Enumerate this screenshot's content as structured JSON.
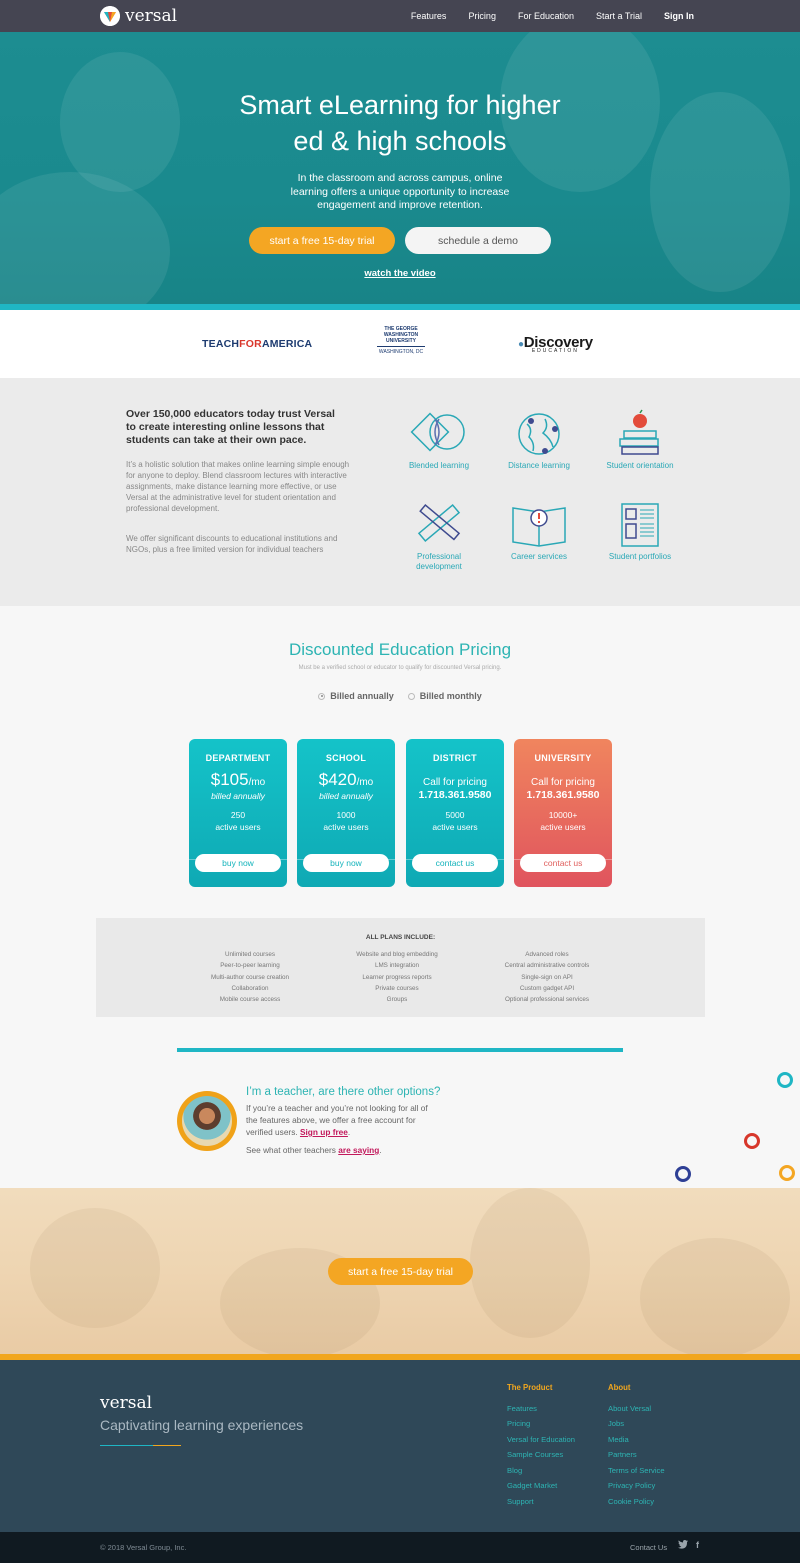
{
  "nav": {
    "brand": "versal",
    "links": [
      "Features",
      "Pricing",
      "For Education",
      "Start a Trial"
    ],
    "signin": "Sign In"
  },
  "hero": {
    "title_line1": "Smart eLearning for higher",
    "title_line2": "ed & high schools",
    "subtitle": "In the classroom and across campus, online learning offers a unique opportunity to increase engagement and improve retention.",
    "trial_button": "start a free 15-day trial",
    "demo_button": "schedule a demo",
    "video_link": "watch the video"
  },
  "partners": {
    "tfa_teach": "TEACH",
    "tfa_for": "FOR",
    "tfa_america": "AMERICA",
    "gwu_name": "THE GEORGE WASHINGTON UNIVERSITY",
    "gwu_loc": "WASHINGTON, DC",
    "discovery": "Discovery",
    "discovery_sub": "EDUCATION"
  },
  "features": {
    "headline": "Over 150,000 educators today trust Versal to create interesting online lessons that students can take at their own pace.",
    "para1": "It’s a holistic solution that makes online learning simple enough for anyone to deploy. Blend classroom lectures with interactive assignments, make distance learning more effective, or use Versal at the administrative level for student orientation and professional development.",
    "para2": "We offer significant discounts to educational institutions and NGOs, plus a free limited version for individual teachers",
    "items": [
      {
        "label": "Blended learning",
        "icon": "blended-learning-icon"
      },
      {
        "label": "Distance learning",
        "icon": "globe-icon"
      },
      {
        "label": "Student orientation",
        "icon": "apple-books-icon"
      },
      {
        "label": "Professional development",
        "icon": "ruler-pencil-icon"
      },
      {
        "label": "Career services",
        "icon": "book-alert-icon"
      },
      {
        "label": "Student portfolios",
        "icon": "portfolio-icon"
      }
    ]
  },
  "pricing": {
    "title": "Discounted Education Pricing",
    "subtitle": "Must be a verified school or educator to qualify for discounted Versal pricing.",
    "billing_annual": "Billed annually",
    "billing_monthly": "Billed monthly",
    "billing_selected": "annually",
    "plans": [
      {
        "name": "DEPARTMENT",
        "price": "$105",
        "per": "/mo",
        "billed": "billed annually",
        "users": "250",
        "users_label": "active users",
        "button": "buy now"
      },
      {
        "name": "SCHOOL",
        "price": "$420",
        "per": "/mo",
        "billed": "billed annually",
        "users": "1000",
        "users_label": "active users",
        "button": "buy now"
      },
      {
        "name": "DISTRICT",
        "call": "Call for pricing",
        "phone": "1.718.361.9580",
        "users": "5000",
        "users_label": "active users",
        "button": "contact us"
      },
      {
        "name": "UNIVERSITY",
        "call": "Call for pricing",
        "phone": "1.718.361.9580",
        "users": "10000+",
        "users_label": "active users",
        "button": "contact us"
      }
    ],
    "included_title": "ALL PLANS INCLUDE:",
    "included": [
      [
        "Unlimited courses",
        "Peer-to-peer learning",
        "Multi-author course creation",
        "Collaboration",
        "Mobile course access"
      ],
      [
        "Website and blog embedding",
        "LMS integration",
        "Learner progress reports",
        "Private courses",
        "Groups"
      ],
      [
        "Advanced roles",
        "Central administrative controls",
        "Single-sign on API",
        "Custom gadget API",
        "Optional professional services"
      ]
    ]
  },
  "teacher": {
    "heading": "I’m a teacher, are there other options?",
    "body": "If you’re a teacher and you’re not looking for all of the features above, we offer a free account for verified users.",
    "signup": "Sign up free",
    "see": "See what other teachers",
    "saying": "are saying"
  },
  "banner": {
    "button": "start a free 15-day trial"
  },
  "footer": {
    "brand": "versal",
    "tagline": "Captivating learning experiences",
    "product_title": "The Product",
    "product_links": [
      "Features",
      "Pricing",
      "Versal for Education",
      "Sample Courses",
      "Blog",
      "Gadget Market",
      "Support"
    ],
    "about_title": "About",
    "about_links": [
      "About Versal",
      "Jobs",
      "Media",
      "Partners",
      "Terms of Service",
      "Privacy Policy",
      "Cookie Policy"
    ],
    "copyright": "© 2018 Versal Group, Inc.",
    "contact": "Contact Us",
    "social": [
      "twitter-icon",
      "facebook-icon"
    ]
  },
  "colors": {
    "teal": "#1fb6c4",
    "orange": "#f4a623",
    "nav": "#454552",
    "footer": "#2f4858",
    "accent_text": "#2db4b3",
    "link_red": "#c2185b"
  }
}
